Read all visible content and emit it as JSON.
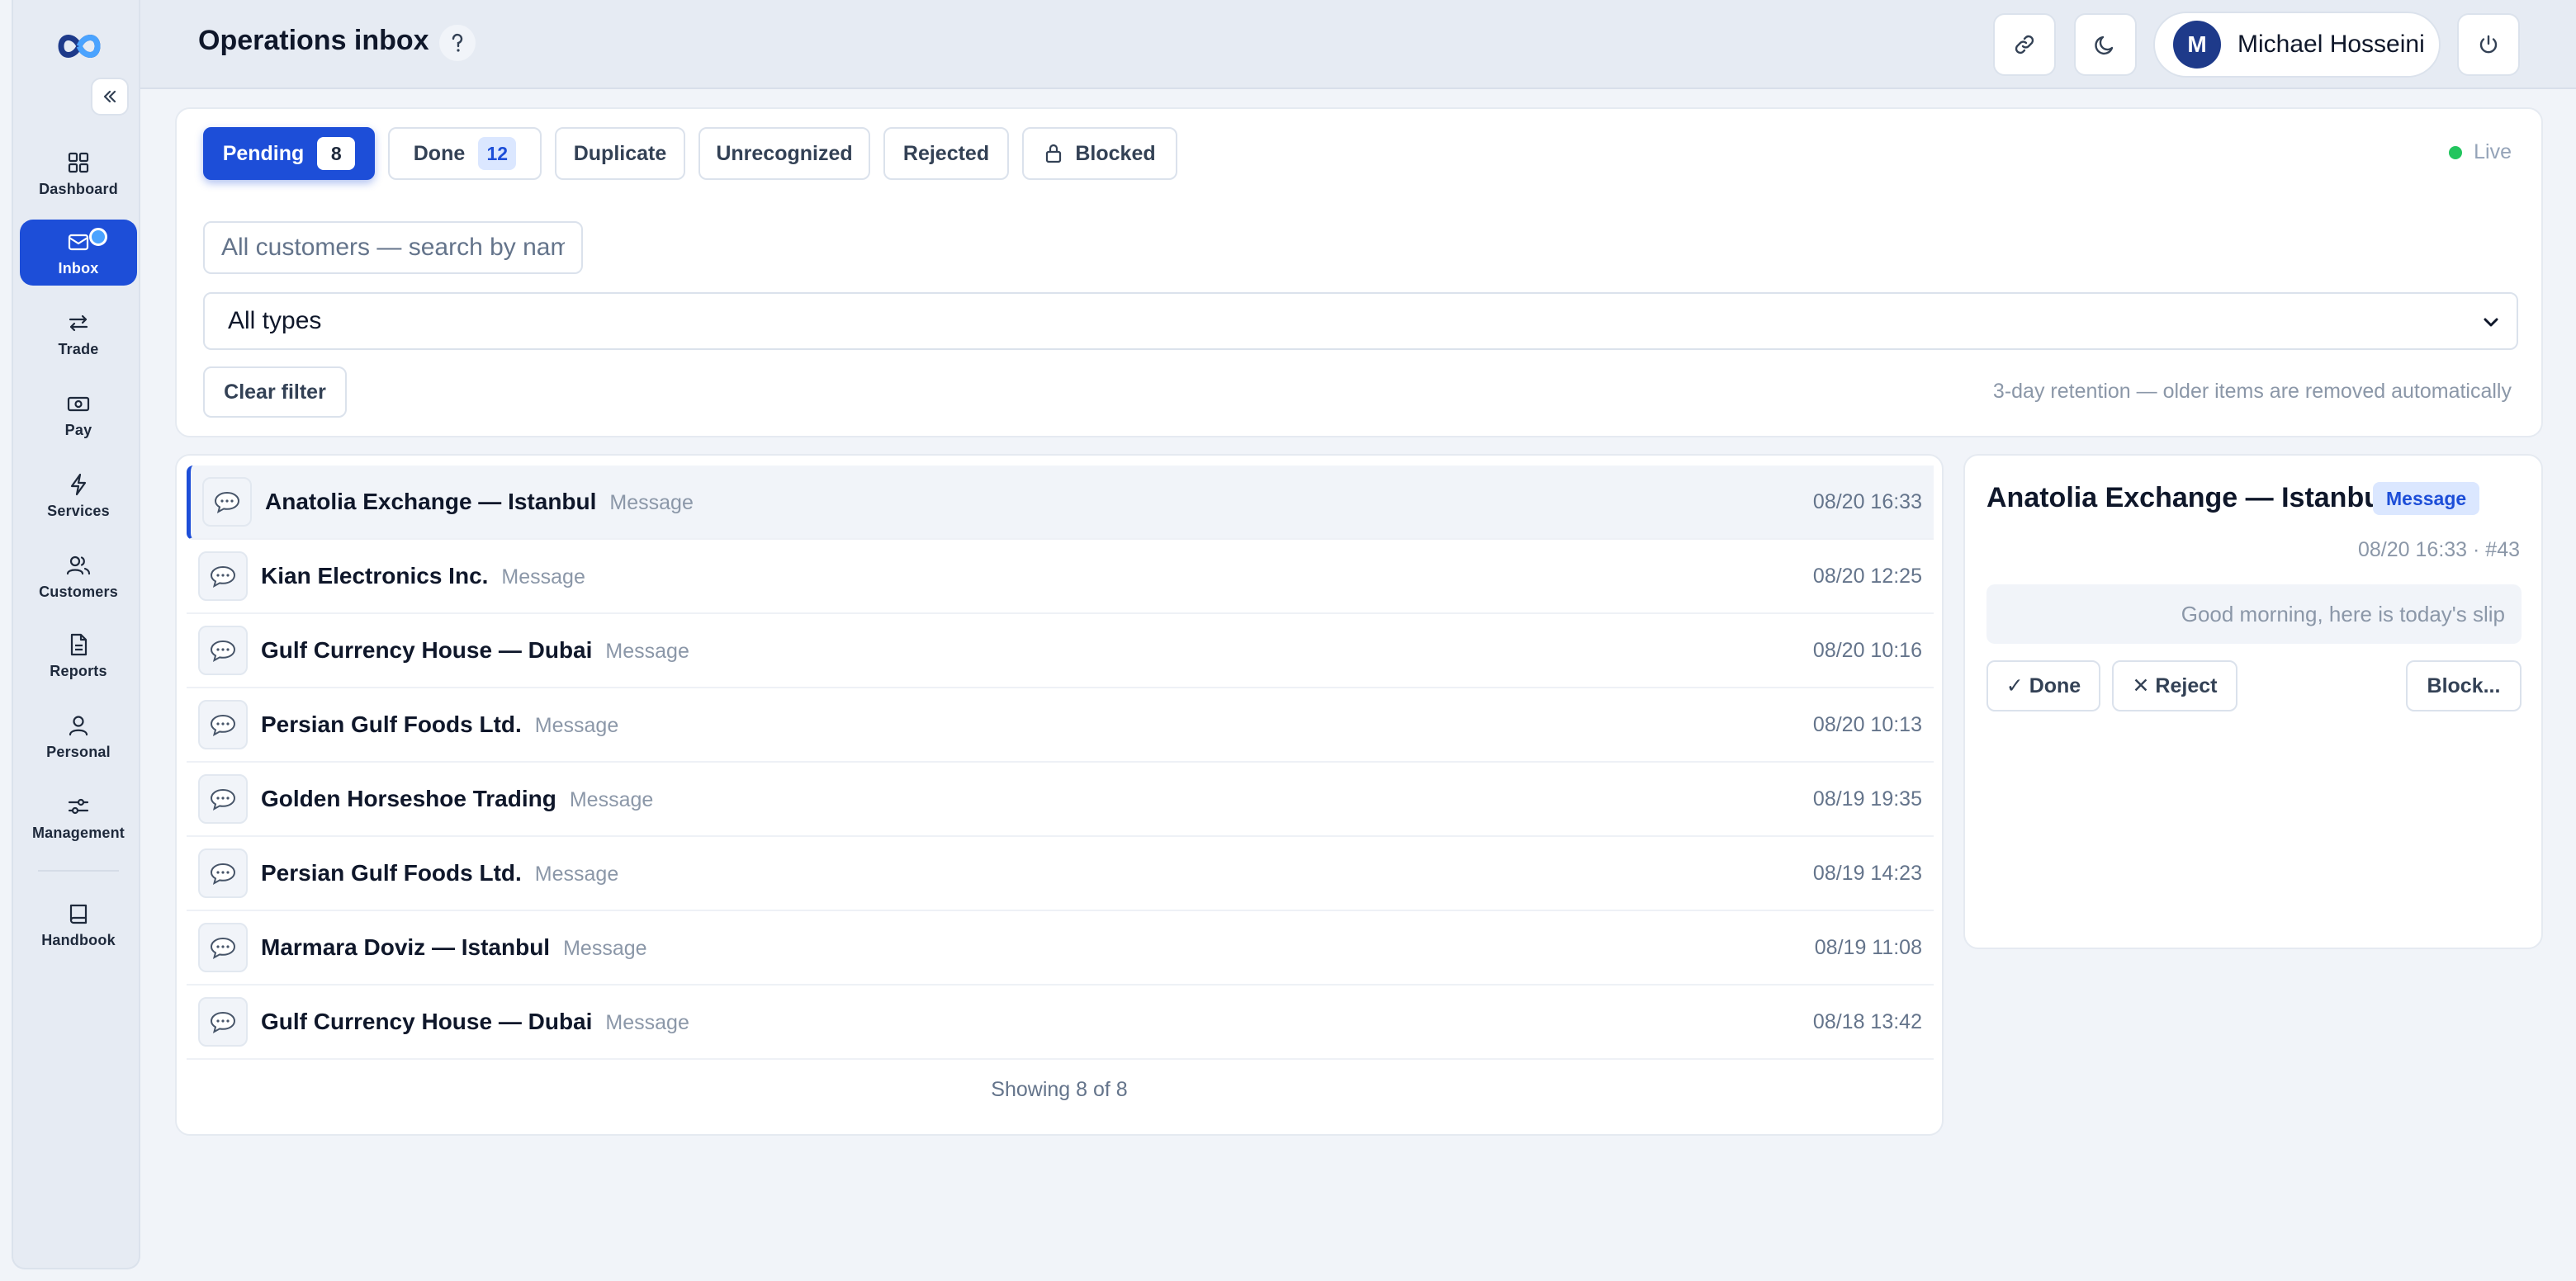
{
  "header": {
    "title": "Operations inbox",
    "user_initial": "M",
    "user_name": "Michael Hosseini"
  },
  "sidebar": {
    "items": [
      {
        "label": "Dashboard",
        "icon": "grid-icon"
      },
      {
        "label": "Inbox",
        "icon": "inbox-icon"
      },
      {
        "label": "Trade",
        "icon": "swap-icon"
      },
      {
        "label": "Pay",
        "icon": "money-icon"
      },
      {
        "label": "Services",
        "icon": "bolt-icon"
      },
      {
        "label": "Customers",
        "icon": "users-icon"
      },
      {
        "label": "Reports",
        "icon": "file-icon"
      },
      {
        "label": "Personal",
        "icon": "user-icon"
      },
      {
        "label": "Management",
        "icon": "sliders-icon"
      },
      {
        "label": "Handbook",
        "icon": "book-icon"
      }
    ]
  },
  "tabs": [
    {
      "label": "Pending",
      "count": "8"
    },
    {
      "label": "Done",
      "count": "12"
    },
    {
      "label": "Duplicate"
    },
    {
      "label": "Unrecognized"
    },
    {
      "label": "Rejected"
    },
    {
      "label": "Blocked"
    }
  ],
  "live_label": "Live",
  "filters": {
    "search_placeholder": "All customers — search by name",
    "type_value": "All types",
    "clear_label": "Clear filter",
    "retention_note": "3-day retention — older items are removed automatically"
  },
  "inbox": {
    "rows": [
      {
        "name": "Anatolia Exchange — Istanbul",
        "kind": "Message",
        "time": "08/20 16:33"
      },
      {
        "name": "Kian Electronics Inc.",
        "kind": "Message",
        "time": "08/20 12:25"
      },
      {
        "name": "Gulf Currency House — Dubai",
        "kind": "Message",
        "time": "08/20 10:16"
      },
      {
        "name": "Persian Gulf Foods Ltd.",
        "kind": "Message",
        "time": "08/20 10:13"
      },
      {
        "name": "Golden Horseshoe Trading",
        "kind": "Message",
        "time": "08/19 19:35"
      },
      {
        "name": "Persian Gulf Foods Ltd.",
        "kind": "Message",
        "time": "08/19 14:23"
      },
      {
        "name": "Marmara Doviz — Istanbul",
        "kind": "Message",
        "time": "08/19 11:08"
      },
      {
        "name": "Gulf Currency House — Dubai",
        "kind": "Message",
        "time": "08/18 13:42"
      }
    ],
    "showing": "Showing 8 of 8"
  },
  "detail": {
    "title": "Anatolia Exchange — Istanbul",
    "badge": "Message",
    "meta": "08/20 16:33 · #43",
    "message": "Good morning, here is today's slip",
    "done_label": "✓ Done",
    "reject_label": "✕ Reject",
    "block_label": "Block..."
  },
  "colors": {
    "accent": "#1d4ed8",
    "live": "#22c55e",
    "background": "#f1f4f9"
  }
}
